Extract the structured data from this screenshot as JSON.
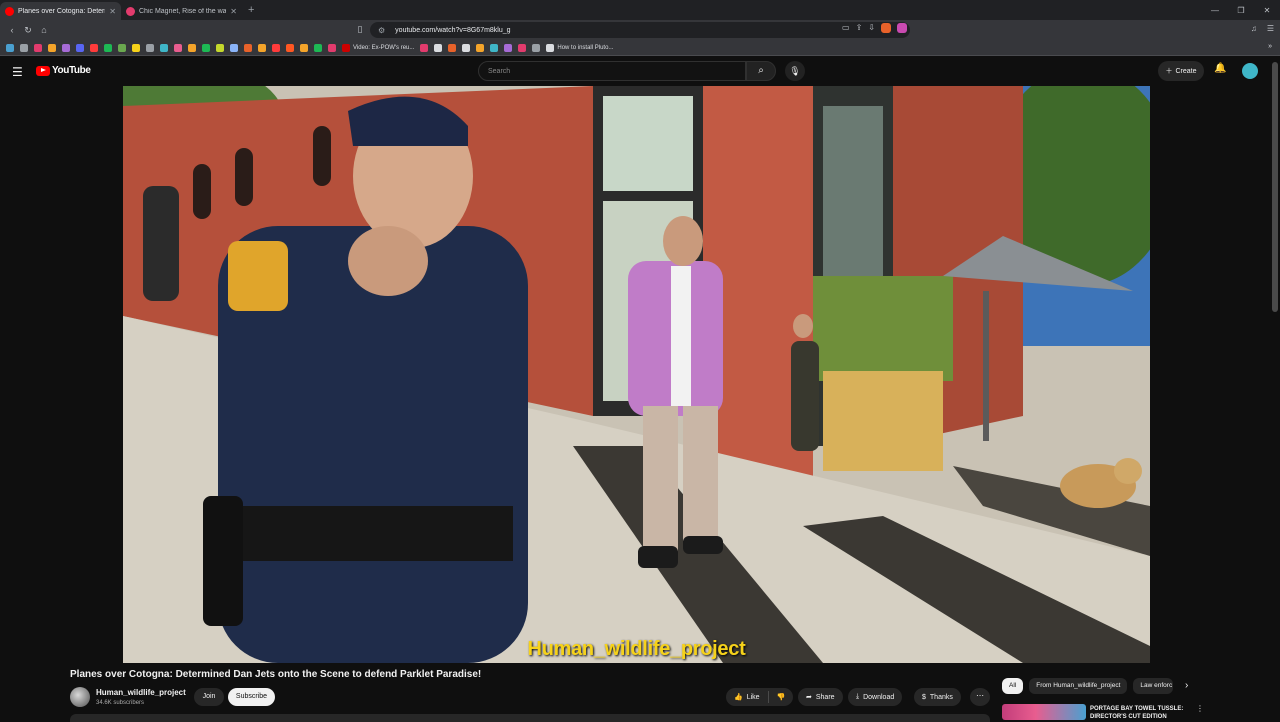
{
  "browser": {
    "tabs": [
      {
        "title": "Planes over Cotogna: Determ",
        "active": true,
        "favicon_color": "#ff0000"
      },
      {
        "title": "Chic Magnet, Rise of the warrior wom",
        "active": false,
        "favicon_color": "#e23b6d"
      }
    ],
    "new_tab_icon": "plus-icon",
    "url": "youtube.com/watch?v=8G67m8klu_g",
    "bookmarks": [
      {
        "label": "Video: Ex-POW's reu..."
      },
      {
        "label": "How to install Pluto..."
      }
    ],
    "window_controls": [
      "minimize-icon",
      "restore-icon",
      "close-icon"
    ]
  },
  "youtube": {
    "logo_text": "YouTube",
    "search_placeholder": "Search",
    "create_label": "Create",
    "brand_color": "#ff0000"
  },
  "video": {
    "caption": "Human_wildlife_project",
    "caption_color": "#f6d21a",
    "title": "Planes over Cotogna: Determined Dan Jets onto the Scene to defend Parklet Paradise!",
    "channel": {
      "name": "Human_wildlife_project",
      "subscribers": "34.6K subscribers",
      "join_label": "Join",
      "subscribe_label": "Subscribe"
    },
    "actions": {
      "like_label": "Like",
      "share_label": "Share",
      "download_label": "Download",
      "thanks_label": "Thanks"
    }
  },
  "sidebar": {
    "chips": [
      "All",
      "From Human_wildlife_project",
      "Law enforc"
    ],
    "recommendation": {
      "title": "PORTAGE BAY TOWEL TUSSLE: DIRECTOR'S CUT EDITION"
    }
  }
}
